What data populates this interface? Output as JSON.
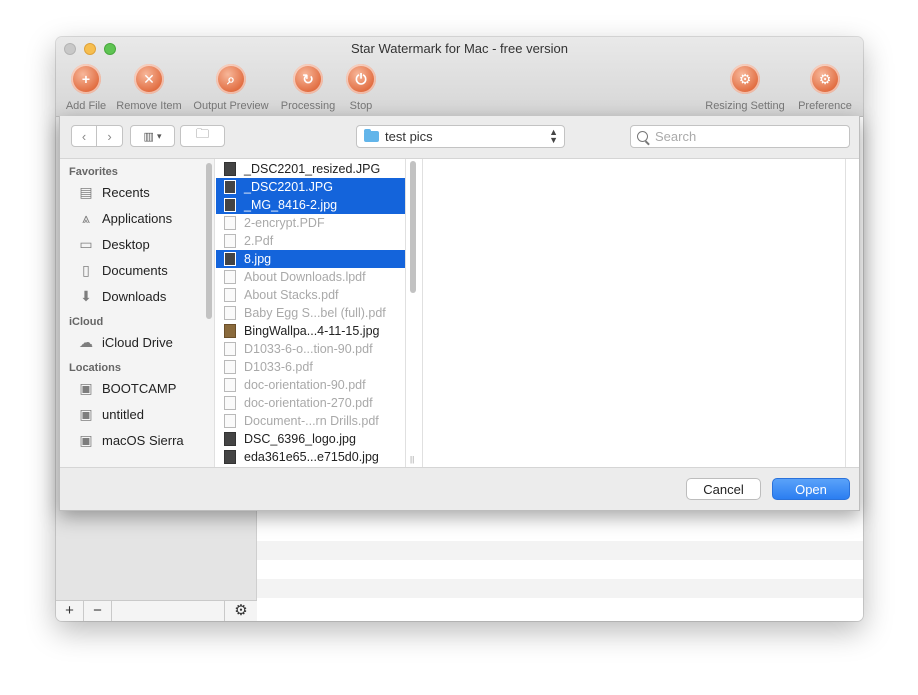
{
  "window": {
    "title": "Star Watermark for Mac - free version"
  },
  "toolbar": {
    "add_file": "Add File",
    "remove_item": "Remove Item",
    "output_preview": "Output Preview",
    "processing": "Processing",
    "stop": "Stop",
    "resizing_setting": "Resizing Setting",
    "preference": "Preference"
  },
  "sheet": {
    "location": "test pics",
    "search_placeholder": "Search",
    "cancel_label": "Cancel",
    "open_label": "Open"
  },
  "sidebar": {
    "favorites_header": "Favorites",
    "favorites": [
      {
        "label": "Recents",
        "icon": "recents-icon"
      },
      {
        "label": "Applications",
        "icon": "applications-icon"
      },
      {
        "label": "Desktop",
        "icon": "desktop-icon"
      },
      {
        "label": "Documents",
        "icon": "documents-icon"
      },
      {
        "label": "Downloads",
        "icon": "downloads-icon"
      }
    ],
    "icloud_header": "iCloud",
    "icloud": [
      {
        "label": "iCloud Drive",
        "icon": "cloud-icon"
      }
    ],
    "locations_header": "Locations",
    "locations": [
      {
        "label": "BOOTCAMP",
        "icon": "disk-icon"
      },
      {
        "label": "untitled",
        "icon": "disk-icon"
      },
      {
        "label": "macOS Sierra",
        "icon": "disk-icon"
      }
    ]
  },
  "files": [
    {
      "name": "_DSC2201_resized.JPG",
      "state": "normal",
      "kind": "img"
    },
    {
      "name": "_DSC2201.JPG",
      "state": "selected",
      "kind": "img"
    },
    {
      "name": "_MG_8416-2.jpg",
      "state": "selected",
      "kind": "img"
    },
    {
      "name": "2-encrypt.PDF",
      "state": "dim",
      "kind": "pdf"
    },
    {
      "name": "2.Pdf",
      "state": "dim",
      "kind": "pdf"
    },
    {
      "name": "8.jpg",
      "state": "selected",
      "kind": "img"
    },
    {
      "name": "About Downloads.lpdf",
      "state": "dim",
      "kind": "pdf"
    },
    {
      "name": "About Stacks.pdf",
      "state": "dim",
      "kind": "pdf"
    },
    {
      "name": "Baby Egg S...bel (full).pdf",
      "state": "dim",
      "kind": "pdf"
    },
    {
      "name": "BingWallpa...4-11-15.jpg",
      "state": "normal",
      "kind": "img2"
    },
    {
      "name": "D1033-6-o...tion-90.pdf",
      "state": "dim",
      "kind": "pdf"
    },
    {
      "name": "D1033-6.pdf",
      "state": "dim",
      "kind": "pdf"
    },
    {
      "name": "doc-orientation-90.pdf",
      "state": "dim",
      "kind": "pdf"
    },
    {
      "name": "doc-orientation-270.pdf",
      "state": "dim",
      "kind": "pdf"
    },
    {
      "name": "Document-...rn Drills.pdf",
      "state": "dim",
      "kind": "pdf"
    },
    {
      "name": "DSC_6396_logo.jpg",
      "state": "normal",
      "kind": "img"
    },
    {
      "name": "eda361e65...e715d0.jpg",
      "state": "normal",
      "kind": "img"
    }
  ],
  "colors": {
    "selection": "#1464db",
    "accent": "#2b7ef1",
    "toolbar_icon": "#e0693c"
  }
}
